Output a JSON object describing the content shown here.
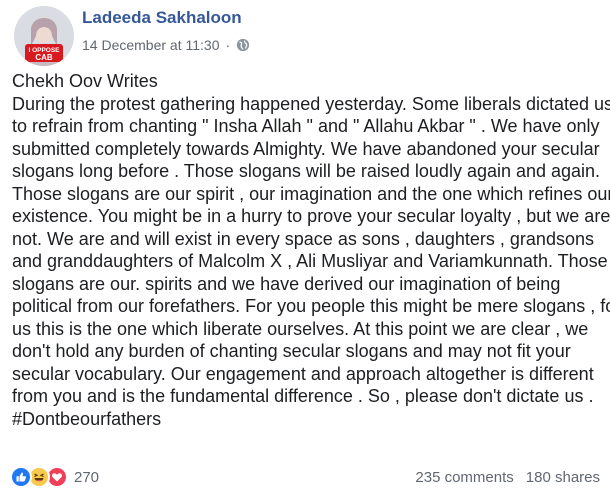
{
  "post": {
    "author": "Ladeeda Sakhaloon",
    "timestamp": "14 December at 11:30",
    "separator": "·",
    "privacy_icon": "globe-icon",
    "avatar_badge": [
      "I OPPOSE",
      "CAB"
    ],
    "body_lines": [
      "Chekh Oov Writes",
      "During the protest gathering happened yesterday. Some liberals dictated us",
      "to refrain from chanting \" Insha Allah \" and \" Allahu Akbar \" . We have only",
      "submitted completely towards Almighty. We have abandoned your secular",
      "slogans long before . Those slogans will be raised loudly again and again.",
      "Those slogans are our spirit , our imagination and the one which refines our",
      "existence. You might be in a hurry to prove your secular loyalty , but we are",
      "not. We are and will exist in every space as sons , daughters , grandsons",
      "and granddaughters of Malcolm X , Ali Musliyar and Variamkunnath. Those",
      "slogans are our. spirits and we have derived our imagination of being",
      "political from our forefathers. For you people this might be mere slogans , for",
      "us this is the one which liberate ourselves. At this point we are clear , we",
      "don't hold any burden of chanting secular slogans and may not fit your",
      "secular vocabulary. Our engagement and approach altogether is different",
      "from you and is the fundamental difference . So , please don't dictate us ."
    ],
    "hashtag": "#Dontbeourfathers"
  },
  "footer": {
    "reactions": [
      "like-icon",
      "haha-icon",
      "love-icon"
    ],
    "reaction_count": "270",
    "comments": "235 comments",
    "shares": "180 shares"
  },
  "colors": {
    "author_link": "#365899",
    "meta_text": "#616770",
    "body_text": "#1c1e21",
    "like": "#2078f4",
    "haha": "#f7c94c",
    "love": "#f33e58"
  }
}
